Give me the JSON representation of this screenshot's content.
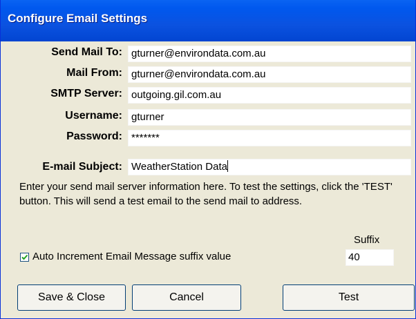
{
  "window": {
    "title": "Configure Email Settings"
  },
  "form": {
    "send_mail_to": {
      "label": "Send Mail To:",
      "value": "gturner@environdata.com.au"
    },
    "mail_from": {
      "label": "Mail From:",
      "value": "gturner@environdata.com.au"
    },
    "smtp_server": {
      "label": "SMTP Server:",
      "value": "outgoing.gil.com.au"
    },
    "username": {
      "label": "Username:",
      "value": "gturner"
    },
    "password": {
      "label": "Password:",
      "value": "*******"
    },
    "email_subject": {
      "label": "E-mail Subject:",
      "value": "WeatherStation Data"
    }
  },
  "info_text": "Enter your send mail server information here. To test the settings, click the 'TEST' button. This will send a test email to the send mail to address.",
  "auto_increment": {
    "label": "Auto Increment Email Message suffix value",
    "checked": true
  },
  "suffix": {
    "label": "Suffix",
    "value": "40"
  },
  "buttons": {
    "save_close": "Save & Close",
    "cancel": "Cancel",
    "test": "Test"
  }
}
